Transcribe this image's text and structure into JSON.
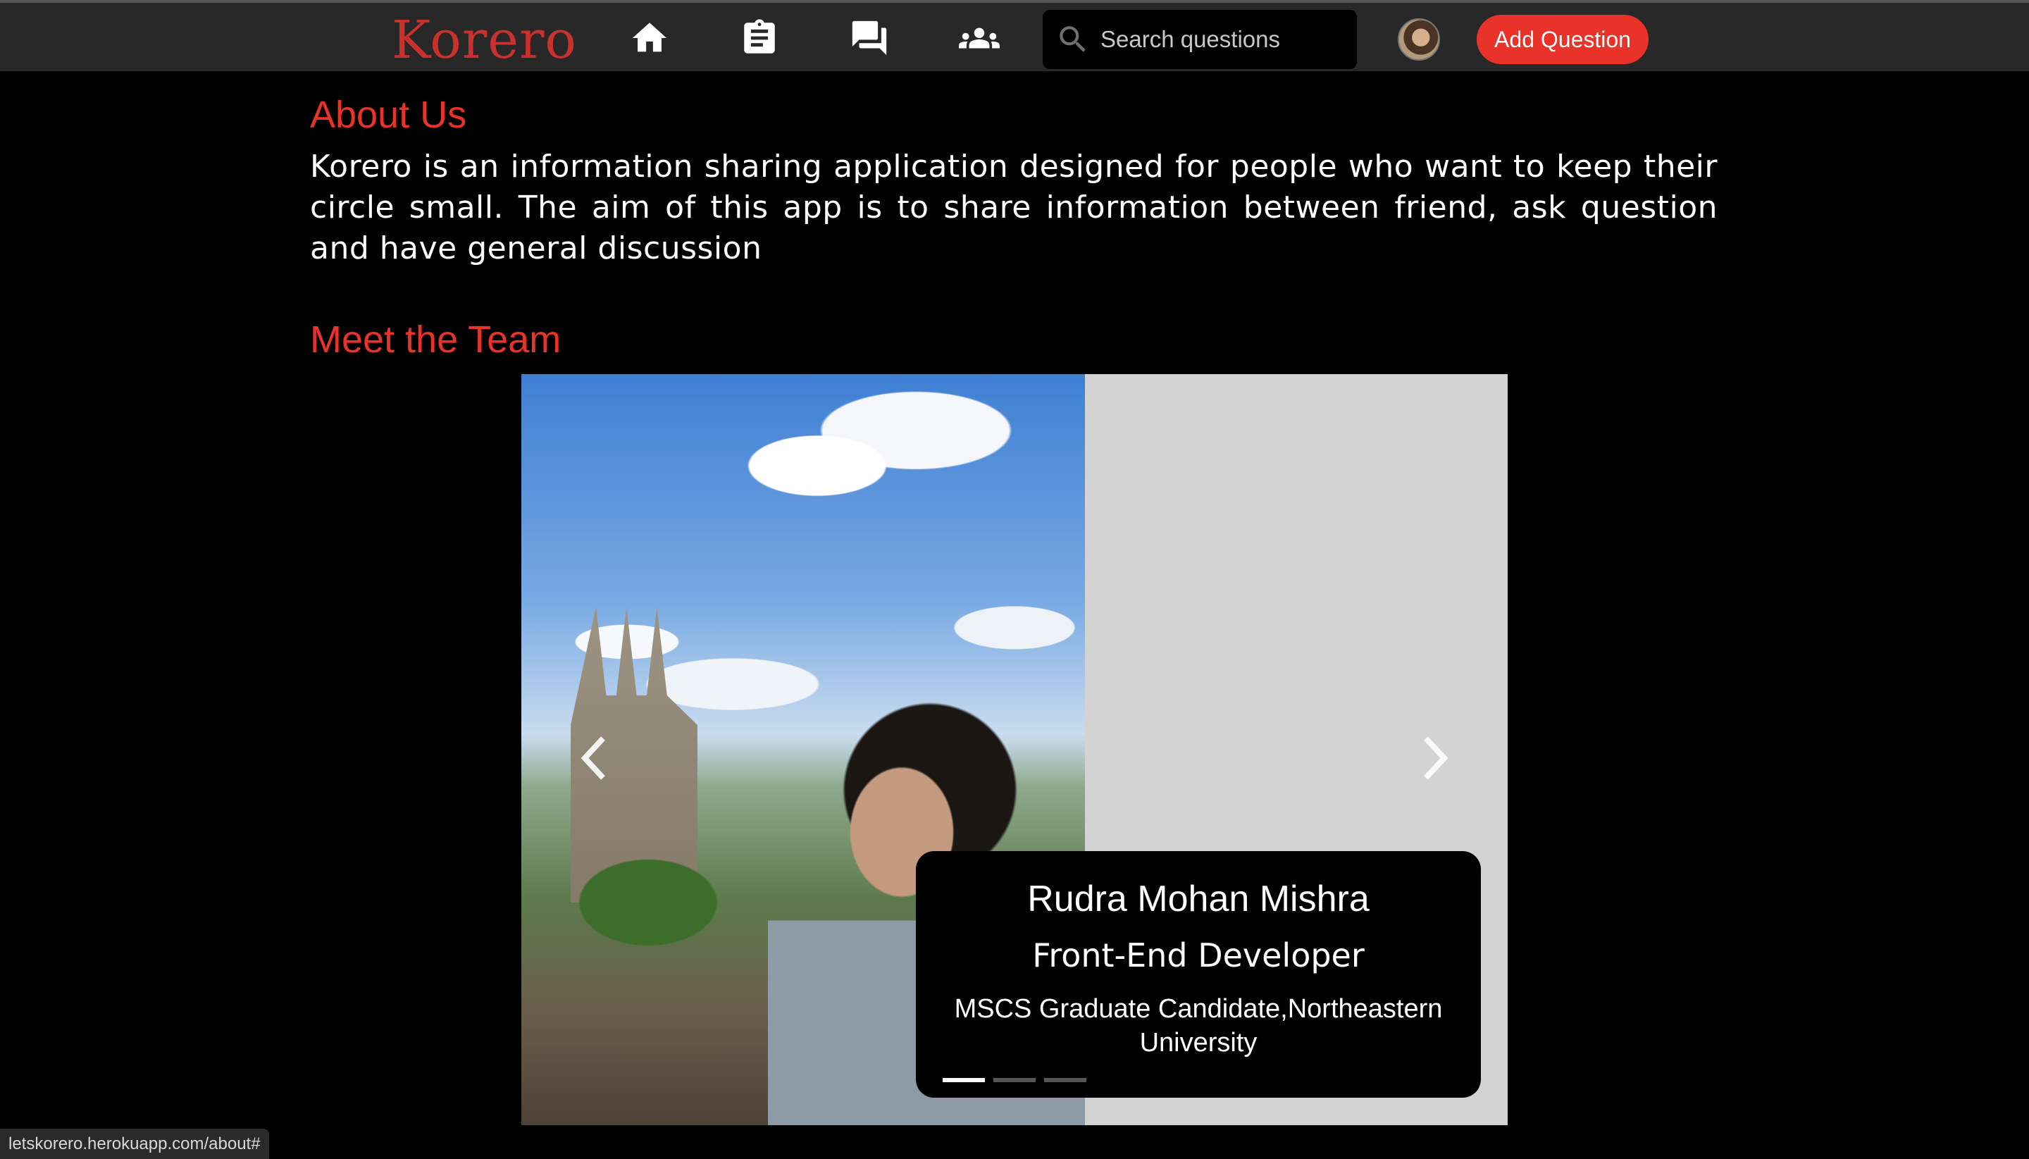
{
  "nav": {
    "brand": "Korero",
    "icons": [
      {
        "name": "home-icon"
      },
      {
        "name": "clipboard-icon"
      },
      {
        "name": "chat-icon"
      },
      {
        "name": "people-icon"
      }
    ],
    "search": {
      "placeholder": "Search questions",
      "value": ""
    },
    "add_question_label": "Add Question"
  },
  "about": {
    "title": "About Us",
    "body": "Korero is an information sharing application designed for people who want to keep their circle small. The aim of this app is to share information between friend, ask question and have general discussion"
  },
  "team": {
    "title": "Meet the Team",
    "slide": {
      "name": "Rudra Mohan Mishra",
      "role": "Front-End Developer",
      "education": "MSCS Graduate Candidate,Northeastern University"
    },
    "active_index": 0,
    "indicator_count": 3
  },
  "status_bar": {
    "url": "letskorero.herokuapp.com/about#"
  },
  "colors": {
    "accent": "#e8322a",
    "brand": "#c8312c",
    "nav_bg": "#282828",
    "page_bg": "#000000"
  }
}
